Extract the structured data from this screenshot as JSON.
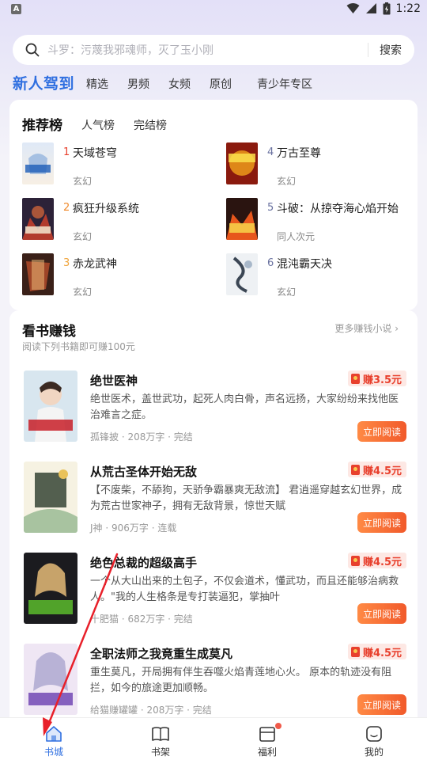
{
  "status_bar": {
    "app_letter": "A",
    "time": "1:22"
  },
  "search": {
    "placeholder": "斗罗：污蔑我邪魂师，灭了玉小刚",
    "button": "搜索"
  },
  "category_tabs": [
    "新人驾到",
    "精选",
    "男频",
    "女频",
    "原创",
    "青少年专区"
  ],
  "ranking": {
    "tabs": [
      "推荐榜",
      "人气榜",
      "完结榜"
    ],
    "items": [
      {
        "rank": "1",
        "title": "天域苍穹",
        "genre": "玄幻"
      },
      {
        "rank": "2",
        "title": "疯狂升级系统",
        "genre": "玄幻"
      },
      {
        "rank": "3",
        "title": "赤龙武神",
        "genre": "玄幻"
      },
      {
        "rank": "4",
        "title": "万古至尊",
        "genre": "玄幻"
      },
      {
        "rank": "5",
        "title": "斗破：从掠夺海心焰开始",
        "genre": "同人次元"
      },
      {
        "rank": "6",
        "title": "混沌霸天决",
        "genre": "玄幻"
      }
    ],
    "rank_colors": {
      "top": "#e8402d",
      "second": "#f08a2b",
      "third": "#f0a43a",
      "other": "#6a72a0"
    }
  },
  "earn": {
    "title": "看书赚钱",
    "subtitle": "阅读下列书籍即可赚100元",
    "more": "更多赚钱小说",
    "read_button": "立即阅读",
    "books": [
      {
        "title": "绝世医神",
        "desc": "绝世医术，盖世武功，起死人肉白骨，声名远扬，大家纷纷来找他医治难言之症。",
        "meta": "孤锋披 · 208万字 · 完结",
        "reward": "赚3.5元"
      },
      {
        "title": "从荒古圣体开始无敌",
        "desc": "【不废柴，不舔狗，天骄争霸暴爽无敌流】 君逍遥穿越玄幻世界，成为荒古世家神子，拥有无敌背景，惊世天赋",
        "meta": "J神 · 906万字 · 连载",
        "reward": "赚4.5元"
      },
      {
        "title": "绝色总裁的超级高手",
        "desc": "一个从大山出来的土包子，不仅会道术，懂武功，而且还能够治病救人。\"我的人生格条是专打装逼犯，掌抽叶",
        "meta": "十肥猫 · 682万字 · 完结",
        "reward": "赚4.5元"
      },
      {
        "title": "全职法师之我竟重生成莫凡",
        "desc": "重生莫凡，开局拥有伴生吞噬火焰青莲地心火。 原本的轨迹没有阻拦，如今的旅途更加顺畅。",
        "meta": "给猫赚罐罐 · 208万字 · 完结",
        "reward": "赚4.5元"
      }
    ]
  },
  "bottom_nav": [
    "书城",
    "书架",
    "福利",
    "我的"
  ],
  "colors": {
    "accent": "#2f6fe0",
    "reward": "#e8402d",
    "button": "#f15a2b",
    "annotation_arrow": "#e8202a"
  }
}
